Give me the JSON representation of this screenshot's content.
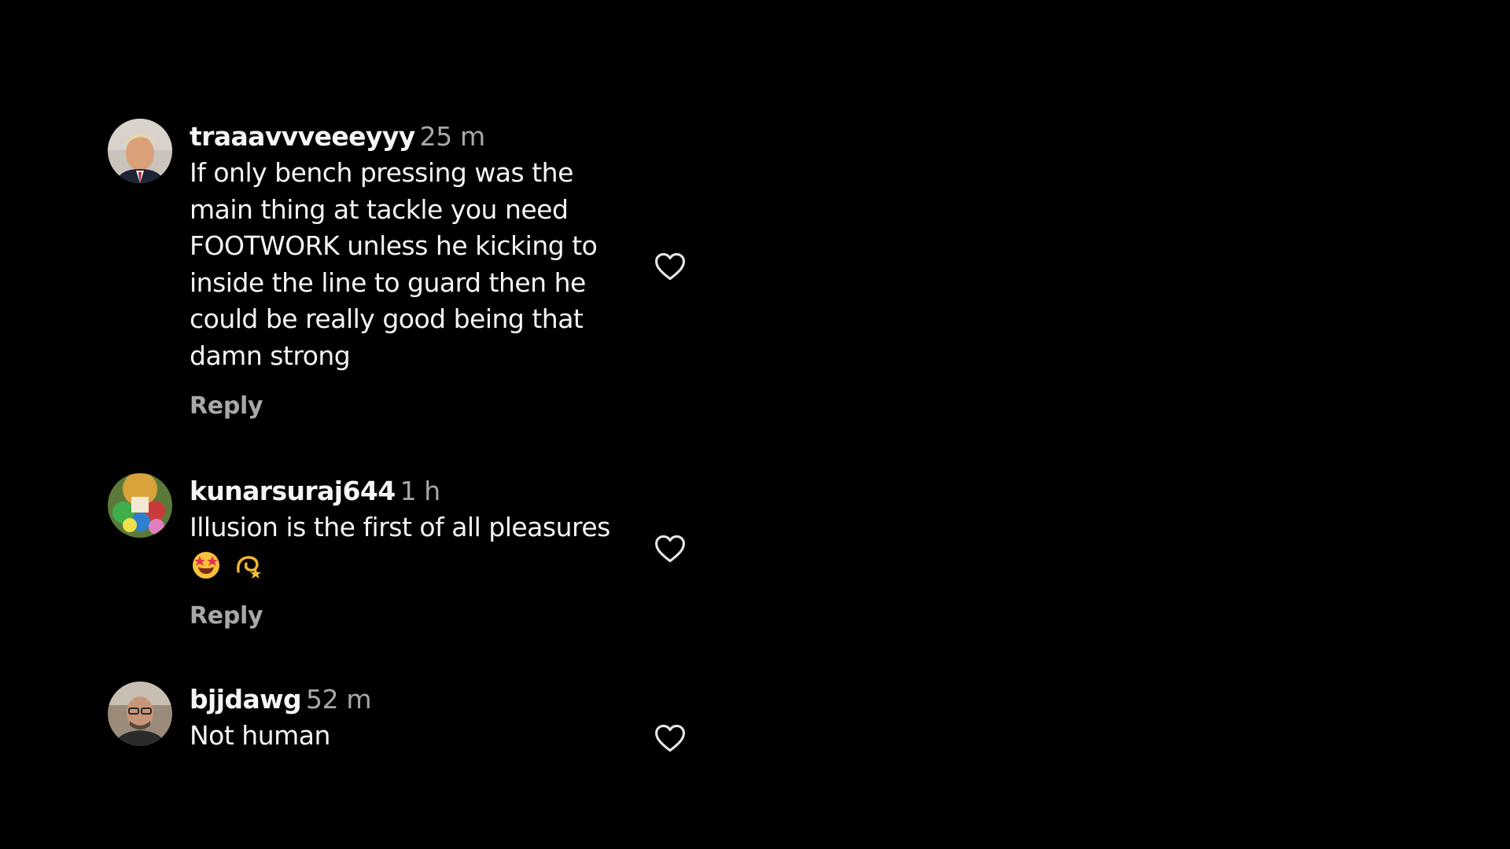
{
  "comments": [
    {
      "avatar_icon": "avatar-photo",
      "username": "traaavvveeeyyy",
      "time": "25 m",
      "text": "If only bench pressing was the\nmain thing at tackle you need\nFOOTWORK unless he kicking to\ninside the line to guard then he\ncould be really good being that\ndamn strong",
      "reply_label": "Reply",
      "like_icon": "heart-icon"
    },
    {
      "avatar_icon": "avatar-photo",
      "username": "kunarsuraj644",
      "time": "1 h",
      "text": "Illusion is the first of all pleasures",
      "emojis": [
        "star-struck-emoji",
        "dizzy-emoji"
      ],
      "reply_label": "Reply",
      "like_icon": "heart-icon"
    },
    {
      "avatar_icon": "avatar-photo",
      "username": "bjjdawg",
      "time": "52 m",
      "text": "Not human",
      "like_icon": "heart-icon"
    }
  ],
  "colors": {
    "background": "#000000",
    "text": "#f5f5f5",
    "secondary_text": "#a8a8a8"
  }
}
